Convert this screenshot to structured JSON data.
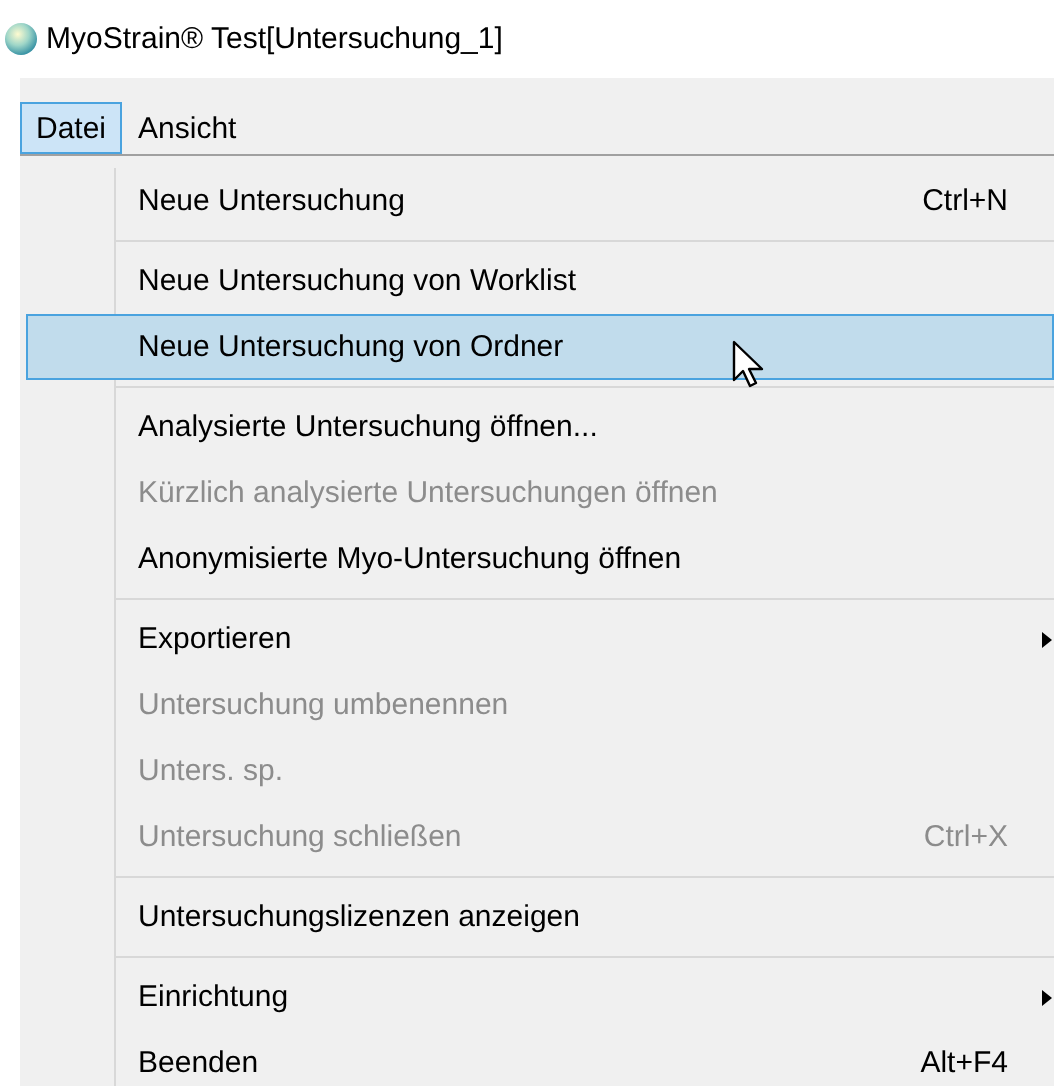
{
  "window": {
    "title": "MyoStrain® Test[Untersuchung_1]"
  },
  "menu_bar": [
    {
      "label": "Datei",
      "selected": true
    },
    {
      "label": "Ansicht",
      "selected": false
    }
  ],
  "menu": {
    "groups": [
      {
        "items": [
          {
            "label": "Neue Untersuchung",
            "shortcut": "Ctrl+N",
            "disabled": false,
            "selected": false,
            "submenu": false
          }
        ]
      },
      {
        "items": [
          {
            "label": "Neue Untersuchung von Worklist",
            "disabled": false,
            "selected": false,
            "submenu": false
          },
          {
            "label": "Neue Untersuchung von Ordner",
            "disabled": false,
            "selected": true,
            "submenu": false
          }
        ]
      },
      {
        "items": [
          {
            "label": "Analysierte Untersuchung öffnen...",
            "disabled": false,
            "selected": false,
            "submenu": false
          },
          {
            "label": "Kürzlich analysierte Untersuchungen öffnen",
            "disabled": true,
            "selected": false,
            "submenu": false
          },
          {
            "label": "Anonymisierte Myo-Untersuchung öffnen",
            "disabled": false,
            "selected": false,
            "submenu": false
          }
        ]
      },
      {
        "items": [
          {
            "label": "Exportieren",
            "disabled": false,
            "selected": false,
            "submenu": true
          },
          {
            "label": "Untersuchung umbenennen",
            "disabled": true,
            "selected": false,
            "submenu": false
          },
          {
            "label": "Unters. sp.",
            "disabled": true,
            "selected": false,
            "submenu": false
          },
          {
            "label": "Untersuchung schließen",
            "shortcut": "Ctrl+X",
            "disabled": true,
            "selected": false,
            "submenu": false
          }
        ]
      },
      {
        "items": [
          {
            "label": "Untersuchungslizenzen anzeigen",
            "disabled": false,
            "selected": false,
            "submenu": false
          }
        ]
      },
      {
        "items": [
          {
            "label": "Einrichtung",
            "disabled": false,
            "selected": false,
            "submenu": true
          },
          {
            "label": "Beenden",
            "shortcut": "Alt+F4",
            "disabled": false,
            "selected": false,
            "submenu": false
          }
        ]
      }
    ]
  }
}
